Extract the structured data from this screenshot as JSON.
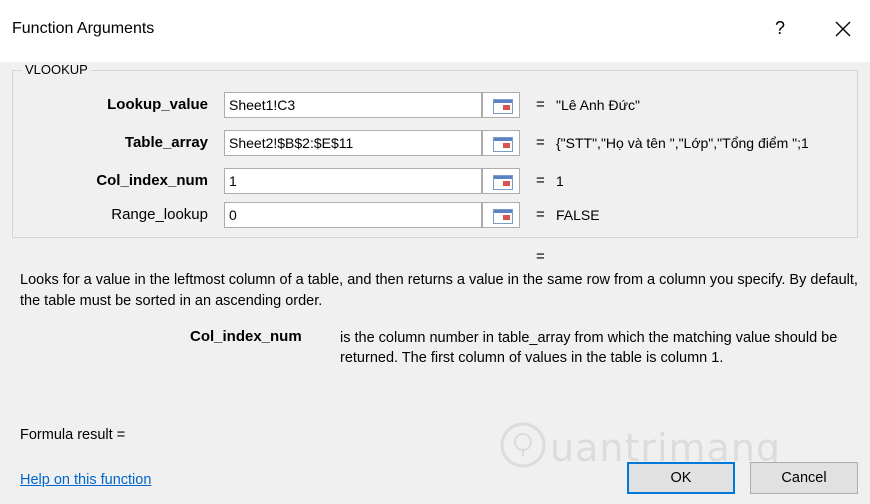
{
  "dialog": {
    "title": "Function Arguments",
    "help_glyph": "?",
    "close_icon": "close-icon"
  },
  "function_group": {
    "name": "VLOOKUP",
    "arguments": [
      {
        "label": "Lookup_value",
        "bold": true,
        "value": "Sheet1!C3",
        "equals": "=",
        "result": "\"Lê Anh Đức\""
      },
      {
        "label": "Table_array",
        "bold": true,
        "value": "Sheet2!$B$2:$E$11",
        "equals": "=",
        "result": "{\"STT\",\"Họ và tên \",\"Lớp\",\"Tổng điểm \";1"
      },
      {
        "label": "Col_index_num",
        "bold": true,
        "value": "1",
        "equals": "=",
        "result": "1"
      },
      {
        "label": "Range_lookup",
        "bold": false,
        "value": "0",
        "equals": "=",
        "result": "FALSE"
      }
    ]
  },
  "function_result_equals": "=",
  "description": "Looks for a value in the leftmost column of a table, and then returns a value in the same row from a column you specify. By default, the table must be sorted in an ascending order.",
  "argument_help": {
    "name": "Col_index_num",
    "text": "is the column number in table_array from which the matching value should be returned. The first column of values in the table is column 1."
  },
  "formula_result_label": "Formula result =",
  "help_link": "Help on this function",
  "buttons": {
    "ok": "OK",
    "cancel": "Cancel"
  },
  "watermark": "uantrimang",
  "colors": {
    "link": "#0066cc",
    "default_button_border": "#0078d7",
    "background": "#f0f0f0"
  }
}
